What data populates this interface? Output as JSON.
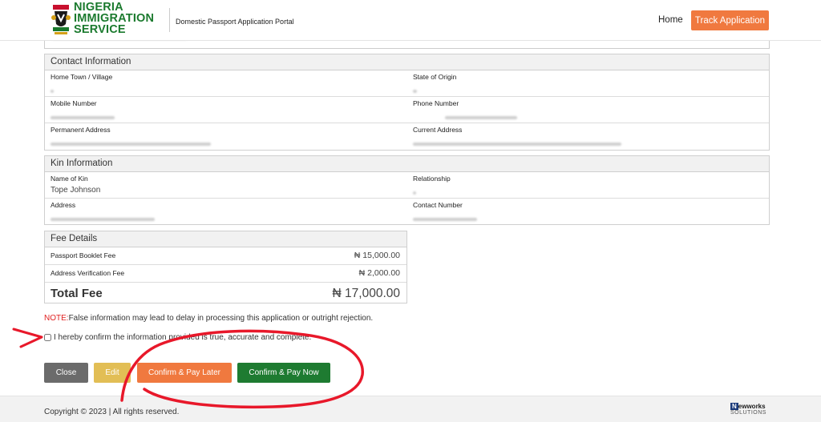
{
  "header": {
    "logo_line1": "NIGERIA",
    "logo_line2": "IMMIGRATION",
    "logo_line3": "SERVICE",
    "portal_title": "Domestic Passport Application Portal",
    "nav_home": "Home",
    "nav_track": "Track Application"
  },
  "contact": {
    "title": "Contact Information",
    "home_town_label": "Home Town / Village",
    "state_origin_label": "State of Origin",
    "mobile_label": "Mobile Number",
    "phone_label": "Phone Number",
    "permanent_address_label": "Permanent Address",
    "current_address_label": "Current Address"
  },
  "kin": {
    "title": "Kin Information",
    "name_label": "Name of Kin",
    "name_value": "Tope Johnson",
    "relationship_label": "Relationship",
    "address_label": "Address",
    "contact_number_label": "Contact Number"
  },
  "fee": {
    "title": "Fee Details",
    "items": [
      {
        "label": "Passport Booklet Fee",
        "amount": "₦ 15,000.00"
      },
      {
        "label": "Address Verification Fee",
        "amount": "₦ 2,000.00"
      }
    ],
    "total_label": "Total Fee",
    "total_amount": "₦ 17,000.00"
  },
  "note": {
    "prefix": "NOTE:",
    "text": "False information may lead to delay in processing this application or outright rejection."
  },
  "confirm_text": "I hereby confirm the information provided is true, accurate and complete.",
  "buttons": {
    "close": "Close",
    "edit": "Edit",
    "later": "Confirm & Pay Later",
    "now": "Confirm & Pay Now"
  },
  "footer": {
    "copyright": "Copyright © 2023 | All rights reserved.",
    "brand_n": "N",
    "brand_rest": "ewworks",
    "brand_sub": "SOLUTIONS"
  },
  "colors": {
    "brand_green": "#1b7a2e",
    "accent_orange": "#f0793f",
    "annotation_red": "#e8182a"
  }
}
